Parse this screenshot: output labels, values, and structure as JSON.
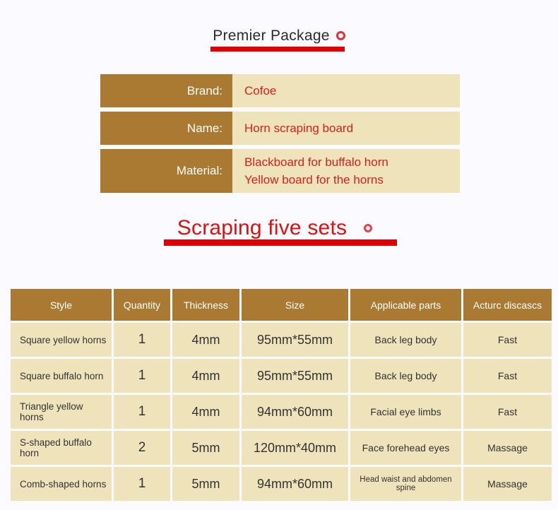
{
  "section1": {
    "title": "Premier Package",
    "icon": "ring-icon",
    "accent_color": "#e00000",
    "info_rows": [
      {
        "label": "Brand:",
        "value_lines": [
          "Cofoe"
        ]
      },
      {
        "label": "Name:",
        "value_lines": [
          "Horn scraping board"
        ]
      },
      {
        "label": "Material:",
        "value_lines": [
          "Blackboard for buffalo horn",
          "Yellow board for the horns"
        ]
      }
    ]
  },
  "section2": {
    "title": "Scraping five sets",
    "icon": "ring-icon",
    "accent_color": "#e00000",
    "table": {
      "headers": [
        "Style",
        "Quantity",
        "Thickness",
        "Size",
        "Applicable parts",
        "Acturc discascs"
      ],
      "rows": [
        {
          "style": "Square yellow horns",
          "quantity": "1",
          "thickness": "4mm",
          "size": "95mm*55mm",
          "parts": "Back leg body",
          "action": "Fast"
        },
        {
          "style": "Square buffalo horn",
          "quantity": "1",
          "thickness": "4mm",
          "size": "95mm*55mm",
          "parts": "Back leg body",
          "action": "Fast"
        },
        {
          "style": "Triangle yellow horns",
          "quantity": "1",
          "thickness": "4mm",
          "size": "94mm*60mm",
          "parts": "Facial eye limbs",
          "action": "Fast"
        },
        {
          "style": "S-shaped buffalo horn",
          "quantity": "2",
          "thickness": "5mm",
          "size": "120mm*40mm",
          "parts": "Face forehead eyes",
          "action": "Massage"
        },
        {
          "style": "Comb-shaped horns",
          "quantity": "1",
          "thickness": "5mm",
          "size": "94mm*60mm",
          "parts": "Head waist and abdomen spine",
          "action": "Massage"
        }
      ]
    }
  },
  "colors": {
    "brown": "#aa7a32",
    "cream": "#efe3bb",
    "red_text": "#d92020",
    "red_bar": "#e00000",
    "background": "#fbfbff"
  }
}
